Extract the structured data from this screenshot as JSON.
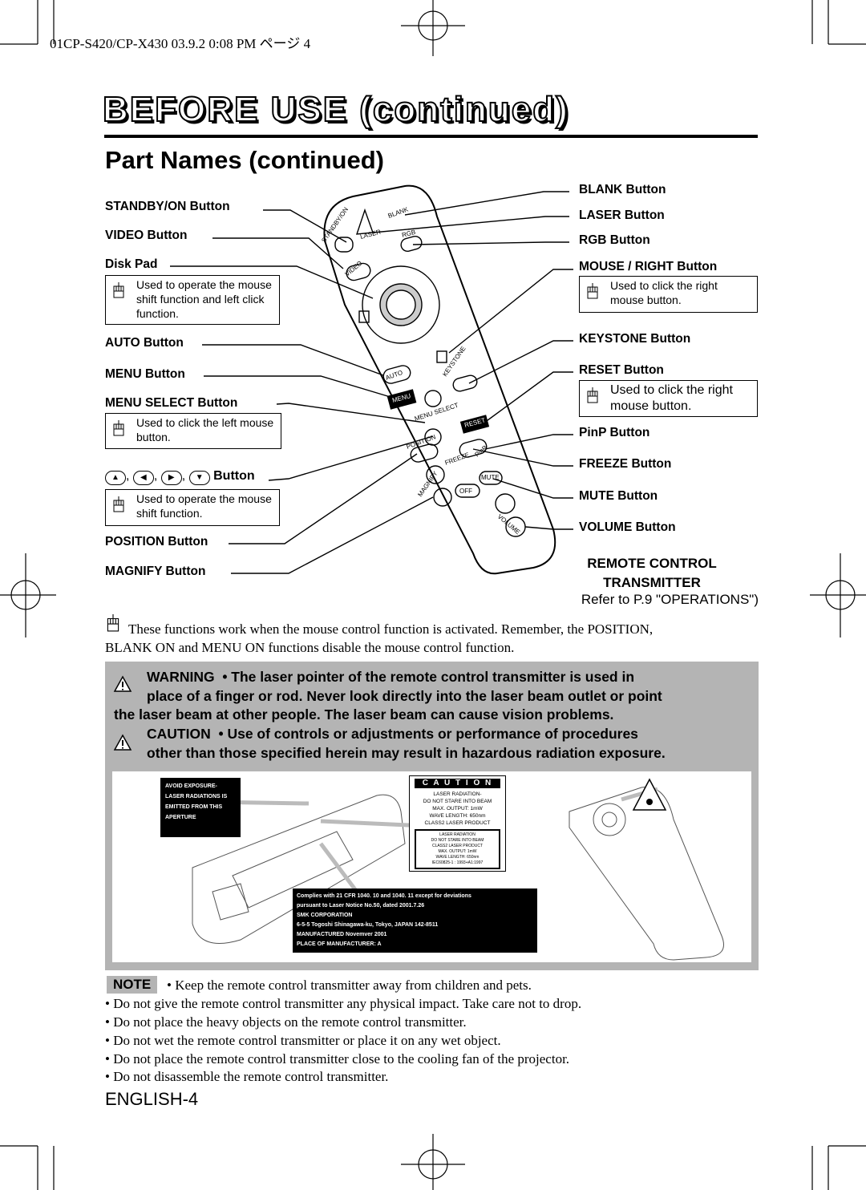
{
  "header": {
    "print_slug": "01CP-S420/CP-X430  03.9.2 0:08 PM  ページ 4"
  },
  "section_title": "BEFORE USE (continued)",
  "subtitle": "Part Names (continued)",
  "left_labels": {
    "standby": "STANDBY/ON Button",
    "video": "VIDEO Button",
    "disk_pad": "Disk Pad",
    "disk_pad_note": "Used to operate the mouse shift function and left click function.",
    "auto": "AUTO Button",
    "menu": "MENU Button",
    "menu_select": "MENU SELECT Button",
    "menu_select_note": "Used to click the left mouse button.",
    "arrows": "Button",
    "arrows_note": "Used to operate the mouse shift function.",
    "position": "POSITION Button",
    "magnify": "MAGNIFY Button"
  },
  "right_labels": {
    "blank": "BLANK Button",
    "laser": "LASER Button",
    "rgb": "RGB Button",
    "mouse_right": "MOUSE / RIGHT Button",
    "mouse_right_note": "Used to click the right mouse button.",
    "keystone": "KEYSTONE Button",
    "reset": "RESET Button",
    "reset_note": "Used to click the right mouse button.",
    "pinp": "PinP Button",
    "freeze": "FREEZE Button",
    "mute": "MUTE Button",
    "volume": "VOLUME Button"
  },
  "remote_keys": [
    "STANDBY/ON",
    "LASER",
    "BLANK",
    "RGB",
    "VIDEO",
    "AUTO",
    "KEYSTONE",
    "MENU",
    "MENU SELECT",
    "RESET",
    "POSITION",
    "FREEZE",
    "PinP",
    "MUTE",
    "MAGNIFY",
    "OFF",
    "VOLUME"
  ],
  "transmitter": {
    "line1": "REMOTE CONTROL",
    "line2": "TRANSMITTER",
    "refer": "Refer to P.9 \"OPERATIONS\")"
  },
  "mouse_note": {
    "line1": "These functions work when the mouse control function is activated. Remember, the POSITION,",
    "line2": "BLANK ON and MENU ON functions disable the mouse control function."
  },
  "warning": {
    "warning_word": "WARNING",
    "w1": "• The laser pointer of the remote control transmitter is used in",
    "w2": "place of a finger or rod. Never look directly into the laser beam outlet or point",
    "w3": "the laser beam at other people. The laser beam can cause vision problems.",
    "caution_word": "CAUTION",
    "c1": "• Use of controls or adjustments or performance of procedures",
    "c2": "other than those specified herein may result in hazardous radiation exposure."
  },
  "labels_figure": {
    "aperture": [
      "AVOID  EXPOSURE-",
      "LASER RADIATIONS IS",
      "EMITTED  FROM  THIS",
      "APERTURE"
    ],
    "caution_title": "C A U T I O N",
    "caution_lines": [
      "LASER  RADIATION-",
      "DO NOT STARE INTO BEAM",
      "MAX. OUTPUT:  1mW",
      "WAVE LENGTH:   650nm",
      "CLASS2 LASER PRODUCT"
    ],
    "inner_lines": [
      "LASER RADIATION",
      "DO NOT STARE INTO BEAM",
      "CLASS2 LASER PRODUCT",
      "MAX.  OUTPUT:  1mW",
      "WAVE LENGTH:  650nm",
      "IEC60825-1 : 1993+A1:1997"
    ],
    "compliance": [
      "Complies with 21 CFR 1040. 10 and 1040. 11 except for deviations",
      "pursuant  to  Laser  Notice  No.50,  dated  2001.7.26",
      "SMK CORPORATION",
      "6-5-5  Togoshi  Shinagawa-ku,  Tokyo,  JAPAN  142-8511",
      "MANUFACTURED   Novemver  2001",
      "PLACE  OF  MANUFACTURER:  A"
    ]
  },
  "note": {
    "tag": "NOTE",
    "bullets": [
      "• Keep the remote control transmitter away from children and pets.",
      "• Do not give the remote control transmitter any physical impact. Take care not to drop.",
      "• Do not place the heavy objects on the remote control transmitter.",
      "• Do not wet the remote control transmitter or place it on any wet object.",
      "• Do not place the remote control transmitter close to the cooling fan of the projector.",
      "• Do not disassemble the remote control transmitter."
    ]
  },
  "footer": {
    "page": "ENGLISH-4"
  },
  "colors": {
    "warning_bg": "#b4b4b4",
    "panel_bg": "#ffffff"
  }
}
